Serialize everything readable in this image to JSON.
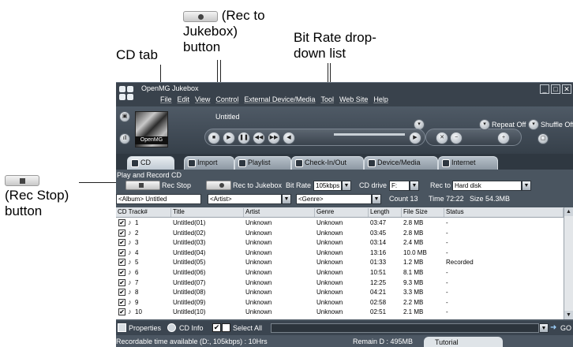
{
  "callouts": {
    "cd_tab": "CD tab",
    "rec_to_jukebox_line1": "(Rec to",
    "rec_to_jukebox_line2": "Jukebox)",
    "rec_to_jukebox_line3": "button",
    "bitrate_line1": "Bit Rate drop-",
    "bitrate_line2": "down list",
    "rec_stop_line1": "(Rec Stop)",
    "rec_stop_line2": "button"
  },
  "app": {
    "title": "OpenMG Jukebox",
    "menu": [
      "File",
      "Edit",
      "View",
      "Control",
      "External Device/Media",
      "Tool",
      "Web Site",
      "Help"
    ],
    "track_title": "Untitled",
    "art_label": "OpenMG",
    "repeat": "Repeat Off",
    "shuffle": "Shuffle Off"
  },
  "tabs": [
    "CD",
    "Import",
    "Playlist",
    "Check-In/Out",
    "Device/Media",
    "Internet"
  ],
  "panel": {
    "heading": "Play and Record CD",
    "rec_stop": "Rec Stop",
    "rec_to_jukebox": "Rec to Jukebox",
    "bit_rate_label": "Bit Rate",
    "bit_rate_value": "105kbps",
    "cd_drive_label": "CD drive",
    "cd_drive_value": "F:",
    "rec_to_label": "Rec to",
    "rec_to_value": "Hard disk",
    "album": "<Album> Untitled",
    "artist": "<Artist>",
    "genre": "<Genre>",
    "count": "Count 13",
    "time": "Time 72:22",
    "size": "Size 54.3MB"
  },
  "table": {
    "headers": [
      "CD Track#",
      "Title",
      "Artist",
      "Genre",
      "Length",
      "File Size",
      "Status"
    ],
    "rows": [
      [
        "1",
        "Untitled(01)",
        "Unknown",
        "Unknown",
        "03:47",
        "2.8 MB",
        "-"
      ],
      [
        "2",
        "Untitled(02)",
        "Unknown",
        "Unknown",
        "03:45",
        "2.8 MB",
        "-"
      ],
      [
        "3",
        "Untitled(03)",
        "Unknown",
        "Unknown",
        "03:14",
        "2.4 MB",
        "-"
      ],
      [
        "4",
        "Untitled(04)",
        "Unknown",
        "Unknown",
        "13:16",
        "10.0 MB",
        "-"
      ],
      [
        "5",
        "Untitled(05)",
        "Unknown",
        "Unknown",
        "01:33",
        "1.2 MB",
        "Recorded"
      ],
      [
        "6",
        "Untitled(06)",
        "Unknown",
        "Unknown",
        "10:51",
        "8.1 MB",
        "-"
      ],
      [
        "7",
        "Untitled(07)",
        "Unknown",
        "Unknown",
        "12:25",
        "9.3 MB",
        "-"
      ],
      [
        "8",
        "Untitled(08)",
        "Unknown",
        "Unknown",
        "04:21",
        "3.3 MB",
        "-"
      ],
      [
        "9",
        "Untitled(09)",
        "Unknown",
        "Unknown",
        "02:58",
        "2.2 MB",
        "-"
      ],
      [
        "10",
        "Untitled(10)",
        "Unknown",
        "Unknown",
        "02:51",
        "2.1 MB",
        "-"
      ]
    ]
  },
  "bottom": {
    "properties": "Properties",
    "cd_info": "CD Info",
    "select_all": "Select All",
    "go": "GO"
  },
  "status": {
    "recordable": "Recordable time available (D:, 105kbps) : 10Hrs",
    "remain": "Remain D : 495MB",
    "tutorial": "Tutorial"
  }
}
